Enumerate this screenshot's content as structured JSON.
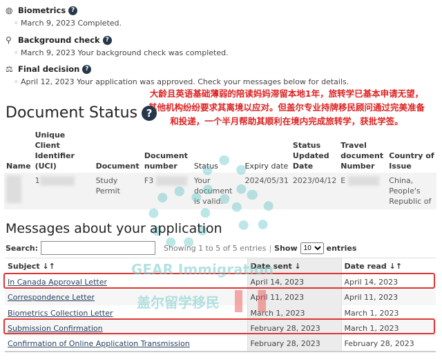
{
  "steps": [
    {
      "icon": "fingerprint-icon",
      "title": "Biometrics",
      "detail": "March 9, 2023 Completed."
    },
    {
      "icon": "search-person-icon",
      "title": "Background check",
      "detail": "March 9, 2023 Your background check was completed."
    },
    {
      "icon": "scale-icon",
      "title": "Final decision",
      "detail": "April 12, 2023 Your application was approved. Check your messages below for details."
    }
  ],
  "note": [
    "大龄且英语基础薄弱的陪读妈妈滞留本地1年，旅转学已基本申请无望，",
    "其他机构纷纷要求其离境以应对。但盖尔专业持牌移民顾问通过完美准备",
    "和投递，一个半月帮助其顺利在境内完成旅转学，获批学签。"
  ],
  "document_status": {
    "title": "Document Status",
    "headers": [
      "Name",
      "Unique Client Identifier (UCI)",
      "Document",
      "Document number",
      "Status",
      "Expiry date",
      "Status Updated Date",
      "Travel document Number",
      "Country of Issue"
    ],
    "row": {
      "name": "",
      "uci": "1",
      "document": "Study Permit",
      "number": "F3",
      "status": "Your document is valid.",
      "expiry": "2024/05/31",
      "updated": "2023/04/12",
      "travel": "E",
      "country": "China, People's Republic of"
    }
  },
  "messages": {
    "title": "Messages about your application",
    "search_label": "Search:",
    "search_value": "",
    "info": "Showing 1 to 5 of 5 entries",
    "show_label": "Show",
    "show_value": "10",
    "entries_label": "entries",
    "headers": [
      "Subject ↓↑",
      "Date sent ↓",
      "Date read ↓↑"
    ],
    "rows": [
      {
        "subject": "In Canada Approval Letter",
        "sent": "April 14, 2023",
        "read": "April 14, 2023"
      },
      {
        "subject": "Correspondence Letter",
        "sent": "April 11, 2023",
        "read": "April 11, 2023"
      },
      {
        "subject": "Biometrics Collection Letter",
        "sent": "March 1, 2023",
        "read": "March 1, 2023"
      },
      {
        "subject": "Submission Confirmation",
        "sent": "February 28, 2023",
        "read": "March 1, 2023"
      },
      {
        "subject": "Confirmation of Online Application Transmission",
        "sent": "February 28, 2023",
        "read": "February 28, 2023"
      }
    ]
  },
  "watermark": {
    "en": "GEAR Immigration",
    "zh": "盖尔留学移民"
  },
  "colors": {
    "highlight": "#dd3333",
    "note": "#dd2222",
    "help": "#26374a",
    "link": "#284162"
  }
}
